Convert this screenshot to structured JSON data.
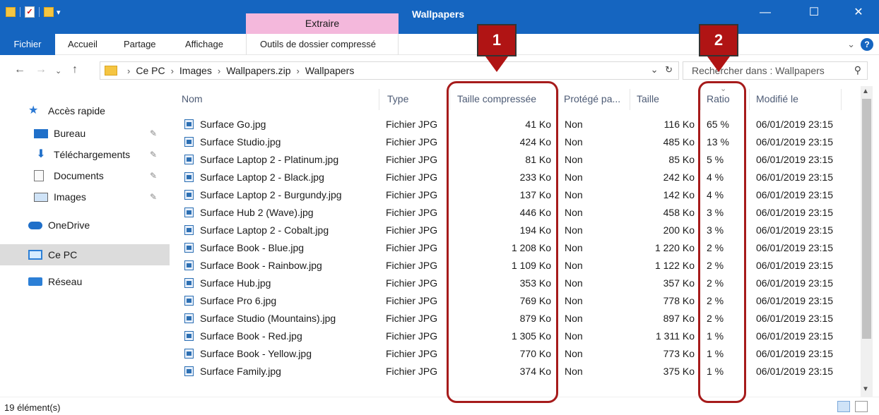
{
  "window": {
    "title": "Wallpapers",
    "context_tab": "Extraire",
    "controls": [
      "—",
      "☐",
      "✕"
    ]
  },
  "ribbon": {
    "tabs": [
      "Fichier",
      "Accueil",
      "Partage",
      "Affichage",
      "Outils de dossier compressé"
    ],
    "collapse": "⌄",
    "help": "?"
  },
  "address": {
    "crumbs": [
      "Ce PC",
      "Images",
      "Wallpapers.zip",
      "Wallpapers"
    ],
    "dropdown": "⌄",
    "refresh": "↻",
    "search_placeholder": "Rechercher dans : Wallpapers"
  },
  "sidebar": {
    "items": [
      {
        "label": "Accès rapide",
        "icon": "star-icon"
      },
      {
        "label": "Bureau",
        "icon": "desktop-icon",
        "pinned": true
      },
      {
        "label": "Téléchargements",
        "icon": "download-icon",
        "pinned": true
      },
      {
        "label": "Documents",
        "icon": "document-icon",
        "pinned": true
      },
      {
        "label": "Images",
        "icon": "pictures-icon",
        "pinned": true
      },
      {
        "label": "OneDrive",
        "icon": "cloud-icon"
      },
      {
        "label": "Ce PC",
        "icon": "computer-icon",
        "selected": true
      },
      {
        "label": "Réseau",
        "icon": "network-icon"
      }
    ]
  },
  "columns": {
    "name": "Nom",
    "type": "Type",
    "compressed": "Taille compressée",
    "protected": "Protégé pa...",
    "size": "Taille",
    "ratio": "Ratio",
    "modified": "Modifié le"
  },
  "files": [
    {
      "name": "Surface Go.jpg",
      "type": "Fichier JPG",
      "compressed": "41 Ko",
      "protected": "Non",
      "size": "116 Ko",
      "ratio": "65 %",
      "modified": "06/01/2019 23:15"
    },
    {
      "name": "Surface Studio.jpg",
      "type": "Fichier JPG",
      "compressed": "424 Ko",
      "protected": "Non",
      "size": "485 Ko",
      "ratio": "13 %",
      "modified": "06/01/2019 23:15"
    },
    {
      "name": "Surface Laptop 2 - Platinum.jpg",
      "type": "Fichier JPG",
      "compressed": "81 Ko",
      "protected": "Non",
      "size": "85 Ko",
      "ratio": "5 %",
      "modified": "06/01/2019 23:15"
    },
    {
      "name": "Surface Laptop 2 - Black.jpg",
      "type": "Fichier JPG",
      "compressed": "233 Ko",
      "protected": "Non",
      "size": "242 Ko",
      "ratio": "4 %",
      "modified": "06/01/2019 23:15"
    },
    {
      "name": "Surface Laptop 2 - Burgundy.jpg",
      "type": "Fichier JPG",
      "compressed": "137 Ko",
      "protected": "Non",
      "size": "142 Ko",
      "ratio": "4 %",
      "modified": "06/01/2019 23:15"
    },
    {
      "name": "Surface Hub 2 (Wave).jpg",
      "type": "Fichier JPG",
      "compressed": "446 Ko",
      "protected": "Non",
      "size": "458 Ko",
      "ratio": "3 %",
      "modified": "06/01/2019 23:15"
    },
    {
      "name": "Surface Laptop 2 - Cobalt.jpg",
      "type": "Fichier JPG",
      "compressed": "194 Ko",
      "protected": "Non",
      "size": "200 Ko",
      "ratio": "3 %",
      "modified": "06/01/2019 23:15"
    },
    {
      "name": "Surface Book - Blue.jpg",
      "type": "Fichier JPG",
      "compressed": "1 208 Ko",
      "protected": "Non",
      "size": "1 220 Ko",
      "ratio": "2 %",
      "modified": "06/01/2019 23:15"
    },
    {
      "name": "Surface Book - Rainbow.jpg",
      "type": "Fichier JPG",
      "compressed": "1 109 Ko",
      "protected": "Non",
      "size": "1 122 Ko",
      "ratio": "2 %",
      "modified": "06/01/2019 23:15"
    },
    {
      "name": "Surface Hub.jpg",
      "type": "Fichier JPG",
      "compressed": "353 Ko",
      "protected": "Non",
      "size": "357 Ko",
      "ratio": "2 %",
      "modified": "06/01/2019 23:15"
    },
    {
      "name": "Surface Pro 6.jpg",
      "type": "Fichier JPG",
      "compressed": "769 Ko",
      "protected": "Non",
      "size": "778 Ko",
      "ratio": "2 %",
      "modified": "06/01/2019 23:15"
    },
    {
      "name": "Surface Studio (Mountains).jpg",
      "type": "Fichier JPG",
      "compressed": "879 Ko",
      "protected": "Non",
      "size": "897 Ko",
      "ratio": "2 %",
      "modified": "06/01/2019 23:15"
    },
    {
      "name": "Surface Book - Red.jpg",
      "type": "Fichier JPG",
      "compressed": "1 305 Ko",
      "protected": "Non",
      "size": "1 311 Ko",
      "ratio": "1 %",
      "modified": "06/01/2019 23:15"
    },
    {
      "name": "Surface Book - Yellow.jpg",
      "type": "Fichier JPG",
      "compressed": "770 Ko",
      "protected": "Non",
      "size": "773 Ko",
      "ratio": "1 %",
      "modified": "06/01/2019 23:15"
    },
    {
      "name": "Surface Family.jpg",
      "type": "Fichier JPG",
      "compressed": "374 Ko",
      "protected": "Non",
      "size": "375 Ko",
      "ratio": "1 %",
      "modified": "06/01/2019 23:15"
    }
  ],
  "status": {
    "count": "19 élément(s)"
  },
  "annotations": {
    "badge1": "1",
    "badge2": "2",
    "color": "#b01414"
  }
}
